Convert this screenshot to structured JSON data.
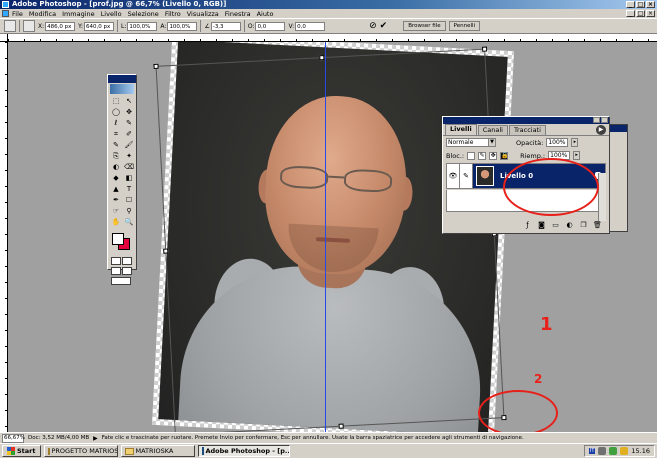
{
  "window": {
    "title": "Adobe Photoshop - [prof.jpg @ 66,7% (Livello 0, RGB)]",
    "controls": [
      "_",
      "□",
      "×"
    ],
    "doc_controls": [
      "_",
      "□",
      "×"
    ]
  },
  "menu": [
    "File",
    "Modifica",
    "Immagine",
    "Livello",
    "Selezione",
    "Filtro",
    "Visualizza",
    "Finestra",
    "Aiuto"
  ],
  "options_bar": {
    "x_label": "X:",
    "x_value": "486,0 px",
    "y_label": "Y:",
    "y_value": "640,0 px",
    "w_label": "L:",
    "w_value": "100,0%",
    "h_label": "A:",
    "h_value": "100,0%",
    "angle_label": "∠",
    "angle_value": "-3,3",
    "hskew_label": "O:",
    "hskew_value": "0,0",
    "vskew_label": "V:",
    "vskew_value": "0,0",
    "cancel_symbol": "⊘",
    "commit_symbol": "✔",
    "tab_browser": "Browser file",
    "tab_brushes": "Pennelli"
  },
  "toolbox": {
    "tools": [
      "⬚",
      "↖",
      "◯",
      "✥",
      "ℓ",
      "✎",
      "⌗",
      "✐",
      "✎",
      "🖌",
      "⎘",
      "✦",
      "◐",
      "⌫",
      "◆",
      "◧",
      "▲",
      "T",
      "✒",
      "☐",
      "☞",
      "⚲",
      "✋",
      "🔍"
    ]
  },
  "layers_panel": {
    "tabs": [
      "Livelli",
      "Canali",
      "Tracciati"
    ],
    "menu_symbol": "▶",
    "blend_mode": "Normale",
    "opacity_label": "Opacità:",
    "opacity_value": "100%",
    "lock_label": "Bloc.:",
    "fill_label": "Riemp.:",
    "fill_value": "100%",
    "layer_name": "Livello 0",
    "eye_symbol": "👁",
    "brush_symbol": "✎"
  },
  "annotations": {
    "label_1": "1",
    "label_2": "2",
    "color": "#e8201a"
  },
  "status_bar": {
    "zoom": "66,67%",
    "doc_info": "Doc: 3,52 MB/4,00 MB",
    "hint": "Fate clic e trascinate per ruotare. Premete Invio per confermare, Esc per annullare. Usate la barra spaziatrice per accedere agli strumenti di navigazione."
  },
  "taskbar": {
    "start_label": "Start",
    "items": [
      "PROGETTO MATRIOSKA",
      "MATRIOSKA",
      "Adobe Photoshop - [p..."
    ],
    "lang": "IT",
    "clock": "15.16"
  }
}
